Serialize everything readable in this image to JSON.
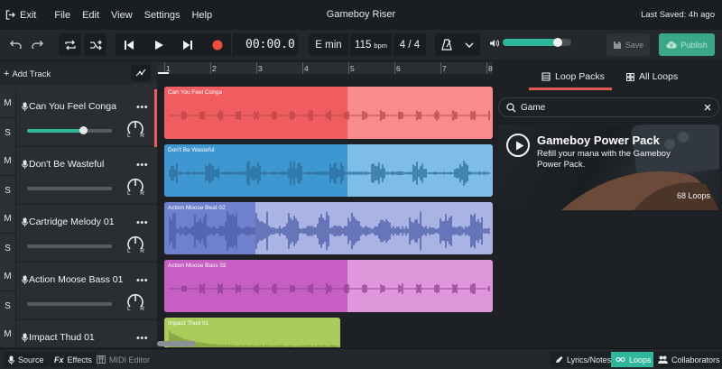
{
  "menu": {
    "exit_label": "Exit",
    "items": [
      "File",
      "Edit",
      "View",
      "Settings",
      "Help"
    ]
  },
  "project": {
    "title": "Gameboy Riser",
    "last_saved": "Last Saved: 4h ago"
  },
  "toolbar": {
    "time": "00:00.0",
    "key": "E min",
    "bpm_value": "115",
    "bpm_unit": "bpm",
    "signature": "4 / 4",
    "master_volume": 0.8,
    "save_label": "Save",
    "publish_label": "Publish"
  },
  "tracks_panel": {
    "add_track_label": "Add Track",
    "mute_label": "M",
    "solo_label": "S",
    "pan_left": "L",
    "pan_right": "R",
    "more_label": "•••",
    "tracks": [
      {
        "name": "Can You Feel Conga",
        "volume": 0.66,
        "active": true
      },
      {
        "name": "Don't Be Wasteful",
        "volume": 0.0,
        "active": false
      },
      {
        "name": "Cartridge Melody 01",
        "volume": 0.0,
        "active": false
      },
      {
        "name": "Action Moose Bass 01",
        "volume": 0.0,
        "active": false
      },
      {
        "name": "Impact Thud 01",
        "volume": 0.0,
        "active": false
      }
    ]
  },
  "timeline": {
    "bars": [
      "1",
      "2",
      "3",
      "4",
      "5",
      "6",
      "7",
      "8"
    ],
    "clips": [
      {
        "label": "Can You Feel Conga",
        "color": "#f05d60",
        "light": "#f88c8d",
        "wave": "#b94346"
      },
      {
        "label": "Don't Be Wasteful",
        "color": "#3f97d1",
        "light": "#7dbde7",
        "wave": "#2b6c99"
      },
      {
        "label": "Action Moose Beat 02",
        "color": "#6f80cc",
        "light": "#a9b4e4",
        "wave": "#4a5aa6"
      },
      {
        "label": "Action Moose Bass 02",
        "color": "#c65ec4",
        "light": "#df97dc",
        "wave": "#8f3d8e"
      },
      {
        "label": "Impact Thud 01",
        "color": "#a9cc5a",
        "light": "#a9cc5a",
        "wave": "#7d9a3a"
      }
    ]
  },
  "browser": {
    "tabs": [
      {
        "label": "Loop Packs",
        "active": true
      },
      {
        "label": "All Loops",
        "active": false
      }
    ],
    "search_value": "Game",
    "search_placeholder": "Search",
    "card": {
      "title": "Gameboy Power Pack",
      "description": "Refill your mana with the Gameboy Power Pack.",
      "count": "68 Loops"
    }
  },
  "bottom": {
    "source_label": "Source",
    "effects_label": "Effects",
    "midi_label": "MIDI Editor",
    "lyrics_label": "Lyrics/Notes",
    "loops_label": "Loops",
    "collab_label": "Collaborators"
  },
  "colors": {
    "accent": "#2fb79b",
    "active_tab": "#e05a4e",
    "record": "#f24c3d",
    "publish_bg": "#3aa887"
  }
}
